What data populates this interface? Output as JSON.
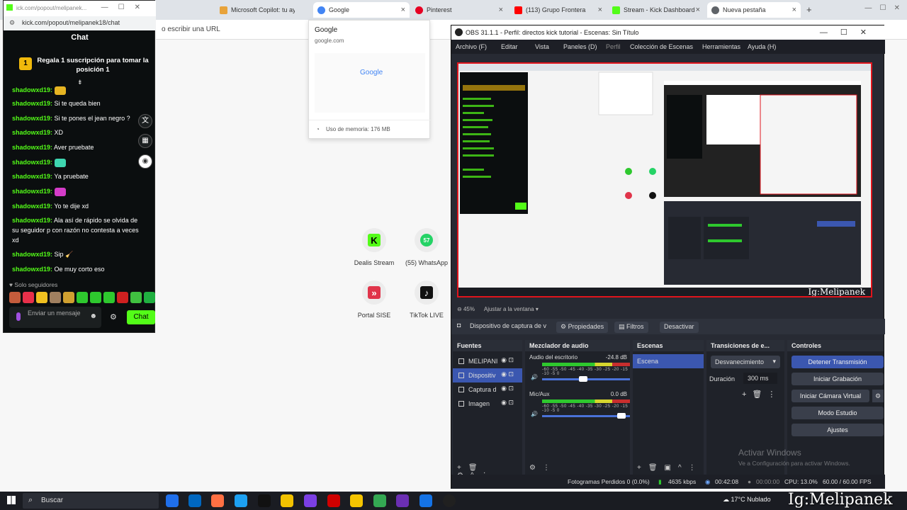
{
  "browser": {
    "tabs": [
      {
        "label": "Microsoft Copilot: tu ayu",
        "color": "#e8a33a"
      },
      {
        "label": "Google",
        "color": "#4285f4"
      },
      {
        "label": "Pinterest",
        "color": "#e60023"
      },
      {
        "label": "(113) Grupo Frontera",
        "color": "#ff0000"
      },
      {
        "label": "Stream - Kick Dashboard",
        "color": "#53fc18"
      },
      {
        "label": "Nueva pestaña",
        "color": "#5f6368"
      }
    ],
    "address_hint": "o escribir una URL",
    "preview": {
      "title": "Google",
      "url": "google.com",
      "thumb_logo": "Google",
      "memory": "Uso de memoria: 176 MB"
    },
    "shortcuts": [
      {
        "label": "Dealis Stream",
        "color": "#53fc18",
        "glyph": "K"
      },
      {
        "label": "(55) WhatsApp",
        "color": "#25d366",
        "glyph": "57"
      },
      {
        "label": "Portal SISE",
        "color": "#e0344a",
        "glyph": "»"
      },
      {
        "label": "TikTok LIVE",
        "color": "#111111",
        "glyph": "♪"
      }
    ]
  },
  "kick": {
    "window_url_short": "ick.com/popout/melipanek...",
    "address": "kick.com/popout/melipanek18/chat",
    "header": "Chat",
    "pinned": {
      "badge": "1",
      "text": "Regala 1 suscripción para tomar la posición 1"
    },
    "messages": [
      {
        "user": "shadowxd19:",
        "text": "Si te queda bien"
      },
      {
        "user": "shadowxd19:",
        "text": "Si te pones el jean negro ?"
      },
      {
        "user": "shadowxd19:",
        "text": "XD"
      },
      {
        "user": "shadowxd19:",
        "text": "Aver pruebate"
      },
      {
        "user": "shadowxd19:",
        "text": ""
      },
      {
        "user": "shadowxd19:",
        "text": "Ya pruebate"
      },
      {
        "user": "shadowxd19:",
        "text": ""
      },
      {
        "user": "shadowxd19:",
        "text": "Yo te dije xd"
      },
      {
        "user": "shadowxd19:",
        "text": "Ala así de rápido se olvida de su seguidor p con razón no contesta a veces xd"
      },
      {
        "user": "shadowxd19:",
        "text": "Sip 🧹"
      },
      {
        "user": "shadowxd19:",
        "text": "Oe muy corto eso"
      }
    ],
    "followers_only": "Solo seguidores",
    "input_placeholder": "Enviar un mensaje",
    "send_label": "Chat"
  },
  "obs": {
    "title": "OBS 31.1.1 - Perfil: directos kick tutorial - Escenas: Sin Título",
    "menu": [
      "Archivo (F)",
      "Editar",
      "Vista",
      "Paneles (D)",
      "Perfil",
      "Colección de Escenas",
      "Herramientas",
      "Ayuda (H)"
    ],
    "zoom": "45%",
    "fit_label": "Ajustar a la ventana",
    "source_bar": {
      "source_name": "Dispositivo de captura de v",
      "properties": "Propiedades",
      "filters": "Filtros",
      "deactivate": "Desactivar"
    },
    "sources": {
      "title": "Fuentes",
      "items": [
        "MELIPANI",
        "Dispositiv",
        "Captura d",
        "Imagen"
      ]
    },
    "mixer": {
      "title": "Mezclador de audio",
      "channels": [
        {
          "name": "Audio del escritorio",
          "db": "-24.8 dB",
          "volume": 0.45
        },
        {
          "name": "Mic/Aux",
          "db": "0.0 dB",
          "volume": 0.9
        }
      ],
      "scale": "-60 -55 -50 -45 -40 -35 -30 -25 -20 -15 -10 -5 0"
    },
    "scenes": {
      "title": "Escenas",
      "items": [
        "Escena"
      ]
    },
    "transitions": {
      "title": "Transiciones de e...",
      "type": "Desvanecimiento",
      "duration_label": "Duración",
      "duration_value": "300 ms"
    },
    "controls": {
      "title": "Controles",
      "buttons": [
        "Detener Transmisión",
        "Iniciar Grabación",
        "Iniciar Cámara Virtual",
        "Modo Estudio",
        "Ajustes"
      ]
    },
    "status": {
      "dropped": "Fotogramas Perdidos 0 (0.0%)",
      "bitrate": "4635 kbps",
      "stream_time": "00:42:08",
      "rec_time": "00:00:00",
      "cpu": "CPU: 13.0%",
      "fps": "60.00 / 60.00 FPS"
    }
  },
  "watermark_windows": {
    "title": "Activar Windows",
    "subtitle": "Ve a Configuración para activar Windows."
  },
  "taskbar": {
    "search": "Buscar",
    "weather": "17°C  Nublado",
    "apps": [
      "#1f6feb",
      "#0067c0",
      "#ff7043",
      "#1da1f2",
      "#111111",
      "#f2c200",
      "#7b3fe4",
      "#d00000",
      "#f5c400",
      "#34a853",
      "#6b2fb3",
      "#1473e6",
      "#202020"
    ]
  },
  "streamer_tag": "Ig:Melipanek"
}
